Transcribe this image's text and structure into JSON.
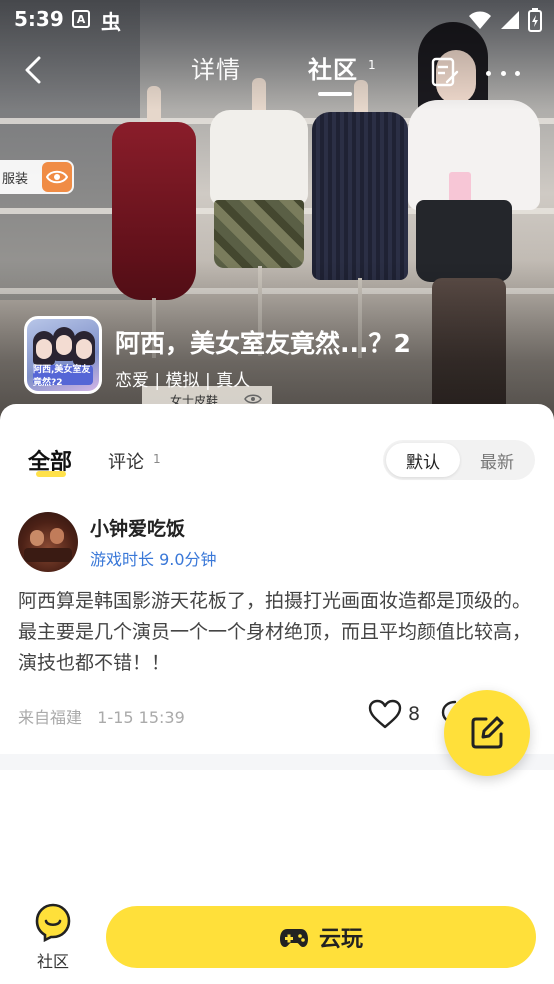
{
  "status_bar": {
    "time": "5:39",
    "a_icon": "A",
    "chong_icon": "虫"
  },
  "nav": {
    "tabs": [
      {
        "label": "详情",
        "active": false
      },
      {
        "label": "社区",
        "active": true,
        "count": "1"
      }
    ]
  },
  "hero": {
    "tag_text": "服装",
    "shoe_sign": "女士皮鞋"
  },
  "game": {
    "icon_title": "阿西,美女室友竟然?2",
    "title": "阿西，美女室友竟然...？2",
    "tags": "恋爱 | 模拟 | 真人"
  },
  "filter": {
    "tab_all": "全部",
    "tab_comment": "评论",
    "comment_count": "1",
    "sort_default": "默认",
    "sort_latest": "最新"
  },
  "post": {
    "username": "小钟爱吃饭",
    "playtime": "游戏时长 9.0分钟",
    "body": "阿西算是韩国影游天花板了，拍摄打光画面妆造都是顶级的。最主要是几个演员一个一个身材绝顶，而且平均颜值比较高，演技也都不错！！",
    "location_time": "来自福建   1-15 15:39",
    "likes": "8"
  },
  "bottom": {
    "community_label": "社区",
    "cloud_play_label": "云玩"
  },
  "colors": {
    "accent_yellow": "#ffe03a",
    "link_blue": "#3a78d8"
  }
}
